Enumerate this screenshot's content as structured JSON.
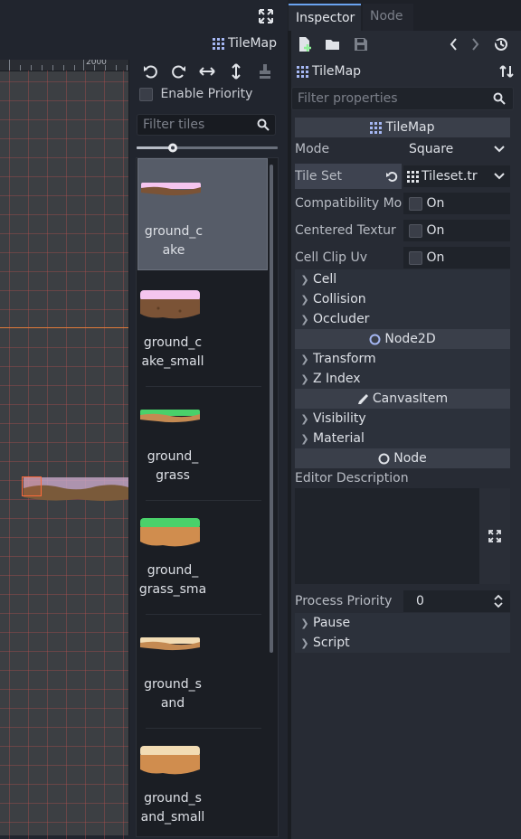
{
  "editor": {
    "node_label": "TileMap",
    "ruler_label": "2000"
  },
  "palette": {
    "enable_priority_label": "Enable Priority",
    "filter_placeholder": "Filter tiles",
    "tiles": [
      {
        "line1": "ground_c",
        "line2": "ake"
      },
      {
        "line1": "ground_c",
        "line2": "ake_small"
      },
      {
        "line1": "ground_",
        "line2": "grass"
      },
      {
        "line1": "ground_",
        "line2": "grass_sma"
      },
      {
        "line1": "ground_s",
        "line2": "and"
      },
      {
        "line1": "ground_s",
        "line2": "and_small"
      }
    ]
  },
  "inspector": {
    "tabs": {
      "inspector": "Inspector",
      "node": "Node"
    },
    "object_title": "TileMap",
    "filter_placeholder": "Filter properties",
    "section_tilemap": "TileMap",
    "mode": {
      "label": "Mode",
      "value": "Square"
    },
    "tile_set": {
      "label": "Tile Set",
      "value": "Tileset.tr"
    },
    "compat": {
      "label": "Compatibility Mo",
      "value": "On"
    },
    "centered": {
      "label": "Centered Textur",
      "value": "On"
    },
    "clip_uv": {
      "label": "Cell Clip Uv",
      "value": "On"
    },
    "cat_cell": "Cell",
    "cat_collision": "Collision",
    "cat_occluder": "Occluder",
    "section_node2d": "Node2D",
    "cat_transform": "Transform",
    "cat_zindex": "Z Index",
    "section_canvasitem": "CanvasItem",
    "cat_visibility": "Visibility",
    "cat_material": "Material",
    "section_node": "Node",
    "editor_description": "Editor Description",
    "process_priority": {
      "label": "Process Priority",
      "value": "0"
    },
    "cat_pause": "Pause",
    "cat_script": "Script"
  }
}
